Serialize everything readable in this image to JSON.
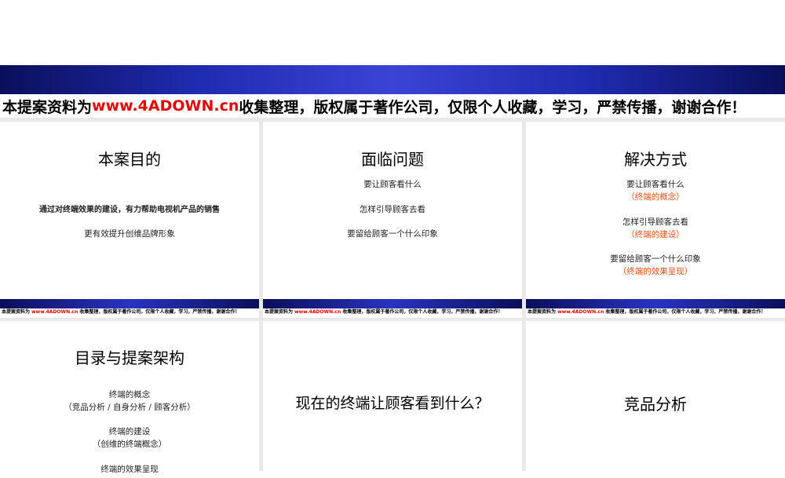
{
  "banner": {
    "prefix": "本提案资料为 ",
    "url": "www.4ADOWN.cn",
    "suffix": " 收集整理，版权属于著作公司，仅限个人收藏，学习，严禁传播，谢谢合作！"
  },
  "slides": [
    {
      "title": "本案目的",
      "lines": [
        {
          "text": "通过对终端效果的建设，有力帮助电视机产品的销售",
          "style": "bold"
        },
        {
          "text": "更有效提升创维品牌形象",
          "style": "normal"
        }
      ]
    },
    {
      "title": "面临问题",
      "lines": [
        {
          "text": "要让顾客看什么",
          "style": "normal"
        },
        {
          "text": "怎样引导顾客去看",
          "style": "normal"
        },
        {
          "text": "要留给顾客一个什么印象",
          "style": "normal"
        }
      ]
    },
    {
      "title": "解决方式",
      "lines": [
        {
          "text": "要让顾客看什么",
          "style": "normal"
        },
        {
          "text": "（终端的概念）",
          "style": "orange"
        },
        {
          "text": "怎样引导顾客去看",
          "style": "normal"
        },
        {
          "text": "（终端的建设）",
          "style": "orange"
        },
        {
          "text": "要留给顾客一个什么印象",
          "style": "normal"
        },
        {
          "text": "（终端的效果呈现）",
          "style": "orange"
        }
      ]
    },
    {
      "title": "目录与提案架构",
      "lines": [
        {
          "text": "终端的概念",
          "style": "normal"
        },
        {
          "text": "（竞品分析 / 自身分析 / 顾客分析）",
          "style": "normal"
        },
        {
          "text": "终端的建设",
          "style": "normal"
        },
        {
          "text": "（创维的终端概念）",
          "style": "normal"
        },
        {
          "text": "终端的效果呈现",
          "style": "normal"
        }
      ]
    },
    {
      "title": "现在的终端让顾客看到什么？",
      "lines": []
    },
    {
      "title": "竞品分析",
      "lines": []
    }
  ]
}
